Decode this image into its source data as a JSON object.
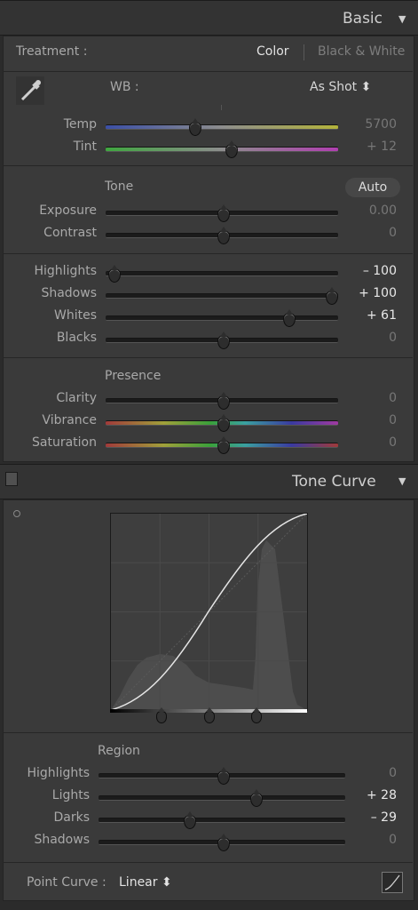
{
  "basic": {
    "title": "Basic",
    "collapse_icon": "triangle-down-icon",
    "treatment": {
      "label": "Treatment :",
      "color": "Color",
      "bw": "Black & White"
    },
    "wb": {
      "label": "WB :",
      "value": "As Shot ⬍"
    },
    "temp": {
      "label": "Temp",
      "value": "5700"
    },
    "tint": {
      "label": "Tint",
      "value": "+ 12"
    },
    "tone": {
      "title": "Tone",
      "auto": "Auto"
    },
    "exposure": {
      "label": "Exposure",
      "value": "0.00"
    },
    "contrast": {
      "label": "Contrast",
      "value": "0"
    },
    "highlights": {
      "label": "Highlights",
      "value": "– 100"
    },
    "shadows": {
      "label": "Shadows",
      "value": "+ 100"
    },
    "whites": {
      "label": "Whites",
      "value": "+ 61"
    },
    "blacks": {
      "label": "Blacks",
      "value": "0"
    },
    "presence": {
      "title": "Presence"
    },
    "clarity": {
      "label": "Clarity",
      "value": "0"
    },
    "vibrance": {
      "label": "Vibrance",
      "value": "0"
    },
    "saturation": {
      "label": "Saturation",
      "value": "0"
    }
  },
  "tone_curve": {
    "title": "Tone Curve",
    "collapse_icon": "triangle-down-icon",
    "region": {
      "title": "Region"
    },
    "highlights": {
      "label": "Highlights",
      "value": "0"
    },
    "lights": {
      "label": "Lights",
      "value": "+ 28"
    },
    "darks": {
      "label": "Darks",
      "value": "– 29"
    },
    "shadows": {
      "label": "Shadows",
      "value": "0"
    },
    "point_curve": {
      "label": "Point Curve :",
      "value": "Linear ⬍"
    }
  },
  "colors": {
    "panel_bg": "#3a3a3a",
    "header_bg": "#333333",
    "curve": "#e6e6e6",
    "histogram": "#5a5a5a"
  }
}
